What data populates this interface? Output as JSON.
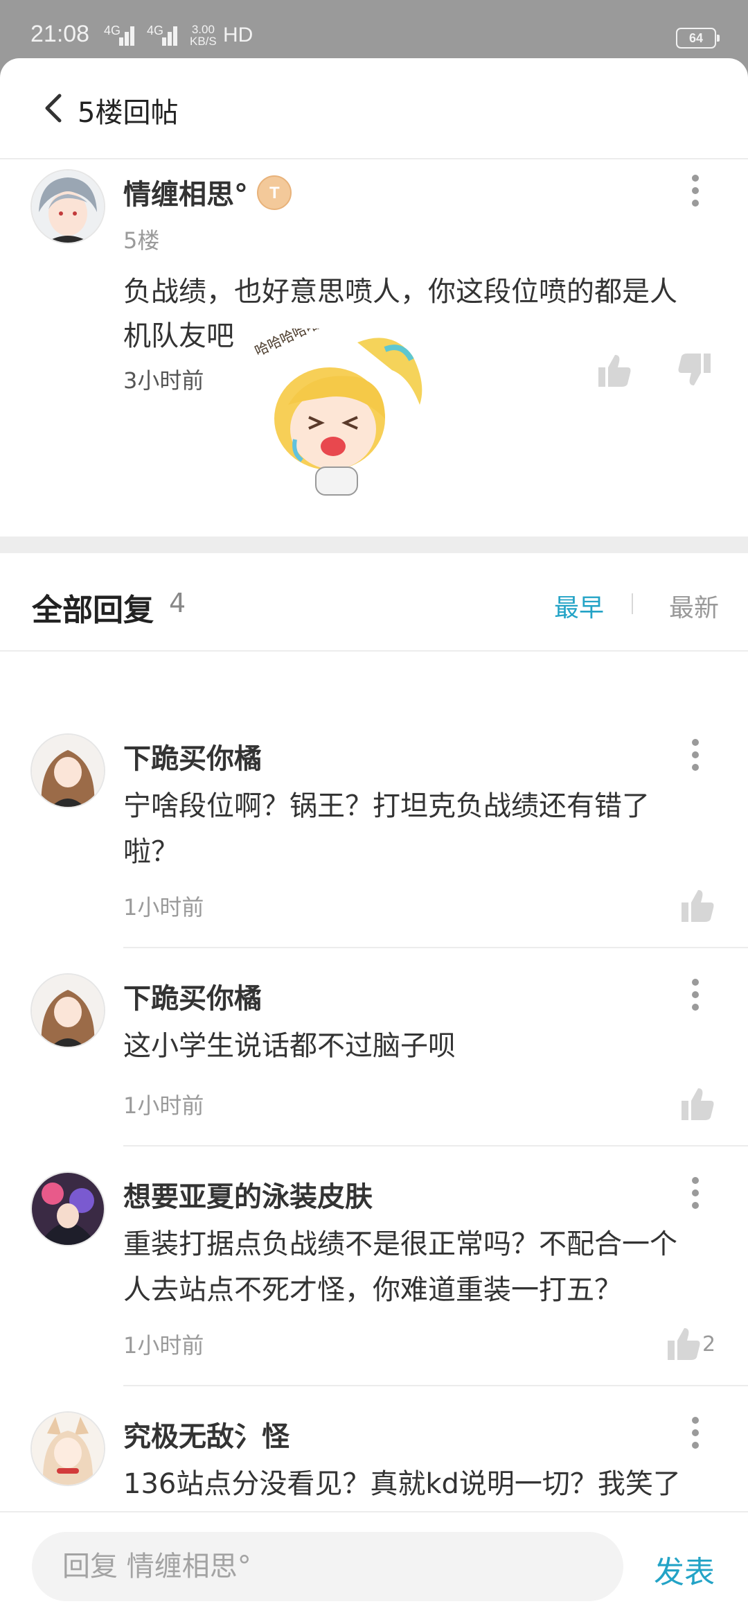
{
  "status_bar": {
    "time": "21:08",
    "net1": "4G",
    "net2": "4G",
    "speed_value": "3.00",
    "speed_unit": "KB/S",
    "hd": "HD",
    "battery": "64"
  },
  "header": {
    "title": "5楼回帖"
  },
  "post": {
    "author": "情缠相思°",
    "badge": "T",
    "floor": "5楼",
    "text_line1": "负战绩，也好意思喷人，你这段位喷的都是人",
    "text_line2": "机队友吧",
    "sticker_text": "哈哈哈哈哈...",
    "time": "3小时前"
  },
  "replies_header": {
    "title": "全部回复",
    "count": "4",
    "sort_earliest": "最早",
    "sort_newest": "最新"
  },
  "replies": [
    {
      "author": "下跪买你橘",
      "line1": "宁啥段位啊？锅王？打坦克负战绩还有错了",
      "line2": "啦？",
      "time": "1小时前",
      "likes": ""
    },
    {
      "author": "下跪买你橘",
      "line1": "这小学生说话都不过脑子呗",
      "line2": "",
      "time": "1小时前",
      "likes": ""
    },
    {
      "author": "想要亚夏的泳装皮肤",
      "line1": "重装打据点负战绩不是很正常吗？不配合一个",
      "line2": "人去站点不死才怪，你难道重装一打五？",
      "time": "1小时前",
      "likes": "2"
    },
    {
      "author": "究极无敌氵怪",
      "line1": "136站点分没看见？真就kd说明一切？我笑了",
      "line2": "",
      "time": "",
      "likes": ""
    }
  ],
  "reply_bar": {
    "placeholder": "回复 情缠相思°",
    "send": "发表"
  },
  "colors": {
    "accent": "#23a3c6",
    "muted": "#9a9a9a",
    "statusbar": "#9a9a9a"
  }
}
